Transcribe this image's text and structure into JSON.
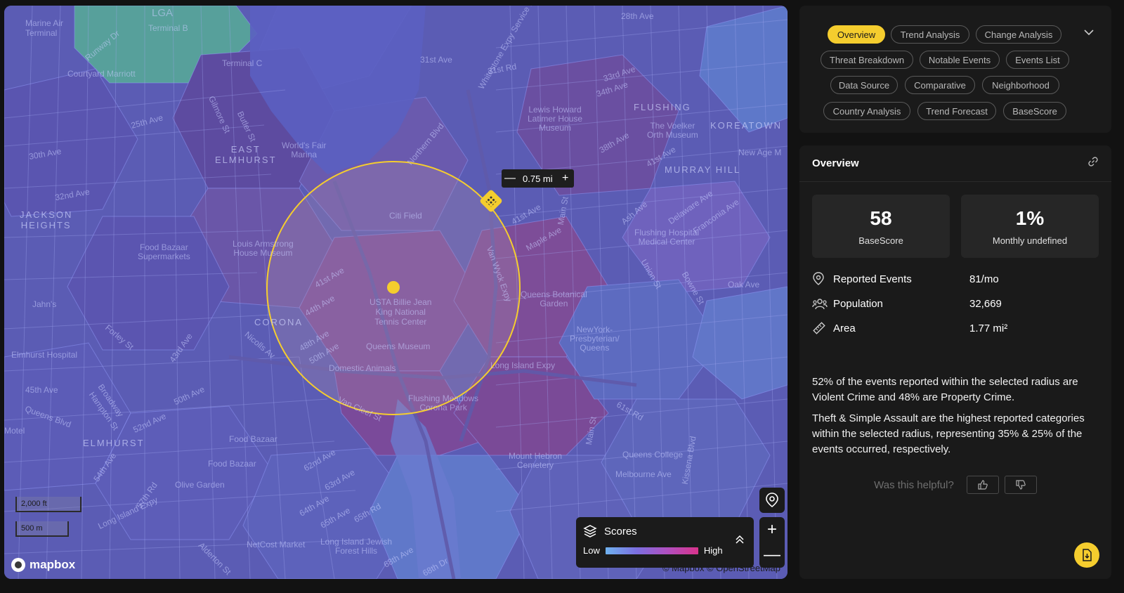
{
  "map": {
    "labels": {
      "lga": "LGA",
      "marine_air_terminal": "Marine Air\nTerminal",
      "terminal_b": "Terminal B",
      "terminal_c": "Terminal C",
      "courtyard_marriott": "Courtyard Marriott",
      "runway_dr": "Runway Dr",
      "east_elmhurst": "EAST\nELMHURST",
      "jackson_heights": "JACKSON\nHEIGHTS",
      "corona": "CORONA",
      "elmhurst": "ELMHURST",
      "flushing": "FLUSHING",
      "koreatown": "KOREATOWN",
      "murray_hill": "MURRAY HILL",
      "worlds_fair_marina": "World's Fair\nMarina",
      "citi_field": "Citi Field",
      "usta": "USTA Billie Jean\nKing National\nTennis Center",
      "queens_museum": "Queens Museum",
      "domestic_animals": "Domestic Animals",
      "flushing_meadows": "Flushing Meadows\nCorona Park",
      "lewis_howard": "Lewis Howard\nLatimer House\nMuseum",
      "voelker": "The Voelker\nOrth Museum",
      "new_age_m": "New Age M",
      "flushing_hospital": "Flushing Hospital\nMedical Center",
      "queens_botanical": "Queens Botanical\nGarden",
      "ny_presbyterian": "NewYork-\nPresbyterian/\nQueens",
      "louis_armstrong": "Louis Armstrong\nHouse Museum",
      "food_bazaar_supermarkets": "Food Bazaar\nSupermarkets",
      "elmhurst_hospital": "Elmhurst Hospital",
      "food_bazaar_1": "Food Bazaar",
      "food_bazaar_2": "Food Bazaar",
      "olive_garden": "Olive Garden",
      "netcost": "NetCost Market",
      "lij": "Long Island Jewish\nForest Hills",
      "mount_hebron": "Mount Hebron\nCemetery",
      "queens_college": "Queens College",
      "jahns": "Jahn's",
      "motel": "Motel",
      "long_island_expy": "Long Island Expy",
      "long_island_expy_2": "Long Island Expy",
      "queens_blvd": "Queens Blvd",
      "northern_blvd": "Northern Blvd",
      "melbourne_ave": "Melbourne Ave",
      "kissena_blvd": "Kissena Blvd",
      "ave_28th": "28th Ave",
      "ave_31st": "31st Ave",
      "ave_33rd": "33rd Ave",
      "ave_34th": "34th Ave",
      "ave_38th": "38th Ave",
      "ave_41st": "41st Ave",
      "ave_41st_b": "41st Ave",
      "ave_41st_c": "41st Ave",
      "ave_44th": "44th Ave",
      "ave_48th": "48th Ave",
      "ave_50th": "50th Ave",
      "ave_50th_b": "50th Ave",
      "ave_52nd": "52nd Ave",
      "ave_62nd": "62nd Ave",
      "ave_63rd": "63rd Ave",
      "ave_64th": "64th Ave",
      "ave_65th": "65th Ave",
      "ave_45th": "45th Ave",
      "ave_30th": "30th Ave",
      "ave_32nd": "32nd Ave",
      "ave_25th": "25th Ave",
      "rd_61st": "61st Rd",
      "rd_65th": "65th Rd",
      "rd_31st": "31st Rd",
      "maple_ave": "Maple Ave",
      "ash_ave": "Ash Ave",
      "oak_ave": "Oak Ave",
      "delaware_ave": "Delaware Ave",
      "franconia_ave": "Franconia Ave",
      "union_st": "Union St",
      "bowne_st": "Bowne St",
      "main_st": "Main St",
      "main_st_2": "Main St",
      "van_wyck": "Van Wyck Expy",
      "whitestone": "Whitestone Expy Service Rd",
      "van_cleef": "Van Cleef St",
      "forley_st": "Forley St",
      "hampton_st": "Hampton St",
      "broadway": "Broadway",
      "nicolls_av": "Nicolls Av",
      "st_43rd": "43rd Ave",
      "st_50th_ave": "50th Ave",
      "st_54th": "54th Ave",
      "st_57th_rd": "57th Rd",
      "gilmore_st": "Gilmore St",
      "butler_st": "Butler St",
      "alderton_st": "Alderton St",
      "ave_68th": "68th Ave",
      "dr_68th": "68th Dr"
    },
    "radius": {
      "value": "0.75 mi",
      "minus": "—",
      "plus": "+"
    },
    "legend": {
      "title": "Scores",
      "low": "Low",
      "high": "High"
    },
    "zoom": {
      "in": "+",
      "out": "—"
    },
    "scale_ft": "2,000 ft",
    "scale_m": "500 m",
    "logo": "mapbox",
    "attribution": "© Mapbox  © OpenStreetMap"
  },
  "tabs": [
    {
      "label": "Overview",
      "active": true
    },
    {
      "label": "Trend Analysis"
    },
    {
      "label": "Change Analysis"
    },
    {
      "label": "Threat Breakdown"
    },
    {
      "label": "Notable Events"
    },
    {
      "label": "Events List"
    },
    {
      "label": "Data Source"
    },
    {
      "label": "Comparative"
    },
    {
      "label": "Neighborhood"
    },
    {
      "label": "Country Analysis"
    },
    {
      "label": "Trend Forecast"
    },
    {
      "label": "BaseScore"
    }
  ],
  "overview": {
    "title": "Overview",
    "stats": [
      {
        "value": "58",
        "label": "BaseScore"
      },
      {
        "value": "1%",
        "label": "Monthly undefined"
      }
    ],
    "metrics": [
      {
        "icon": "location-pin-icon",
        "label": "Reported Events",
        "value": "81/mo"
      },
      {
        "icon": "people-icon",
        "label": "Population",
        "value": "32,669"
      },
      {
        "icon": "ruler-icon",
        "label": "Area",
        "value": "1.77 mi²"
      }
    ],
    "summary_1": "52% of the events reported within the selected radius are Violent Crime and 48% are Property Crime.",
    "summary_2": "Theft & Simple Assault are the highest reported categories within the selected radius, representing 35% & 25% of the events occurred, respectively.",
    "helpful_prompt": "Was this helpful?"
  },
  "colors": {
    "accent": "#f5cd2e",
    "panel": "#1a1a1a",
    "background": "#121212"
  }
}
